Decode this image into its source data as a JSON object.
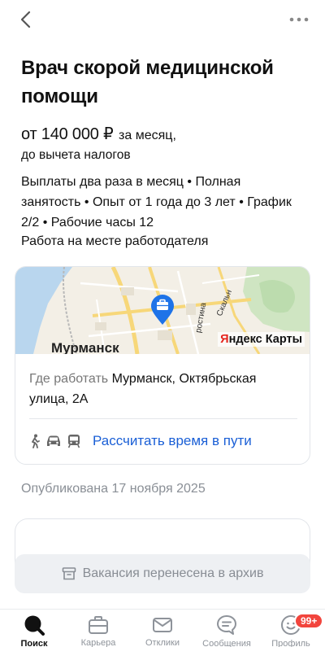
{
  "header": {
    "back_icon": "chevron-left-icon",
    "more_icon": "more-dots-icon"
  },
  "vacancy": {
    "title": "Врач скорой медицинской помощи",
    "salary_amount": "от 140 000 ₽",
    "salary_period": "за месяц,",
    "salary_tax": "до вычета налогов",
    "conditions": "Выплаты два раза в месяц • Полная занятость • Опыт от 1 года до 3 лет • График 2/2 • Рабочие часы 12",
    "workplace": "Работа на месте работодателя"
  },
  "map_card": {
    "map_city_label": "Мурманск",
    "map_brand_ya": "Я",
    "map_brand_rest": "ндекс Карты",
    "map_street_1": "ростина",
    "map_street_2": "Скальн",
    "address_label": "Где работать",
    "address_value": "Мурманск, Октябрьская улица, 2А",
    "route_link": "Рассчитать время в пути",
    "route_icons": [
      "walk-icon",
      "car-icon",
      "transit-icon"
    ]
  },
  "published": "Опубликована 17 ноября 2025",
  "archive": {
    "icon": "archive-icon",
    "text": "Вакансия перенесена в архив"
  },
  "tabs": [
    {
      "label": "Поиск",
      "icon": "search-icon",
      "active": true
    },
    {
      "label": "Карьера",
      "icon": "briefcase-icon",
      "active": false
    },
    {
      "label": "Отклики",
      "icon": "mail-icon",
      "active": false
    },
    {
      "label": "Сообщения",
      "icon": "chat-icon",
      "active": false
    },
    {
      "label": "Профиль",
      "icon": "profile-icon",
      "active": false,
      "badge": "99+"
    }
  ],
  "colors": {
    "link": "#1a5fd6",
    "badge": "#f2453d",
    "map_pin": "#1e73e8",
    "muted_text": "#8a8f96"
  }
}
